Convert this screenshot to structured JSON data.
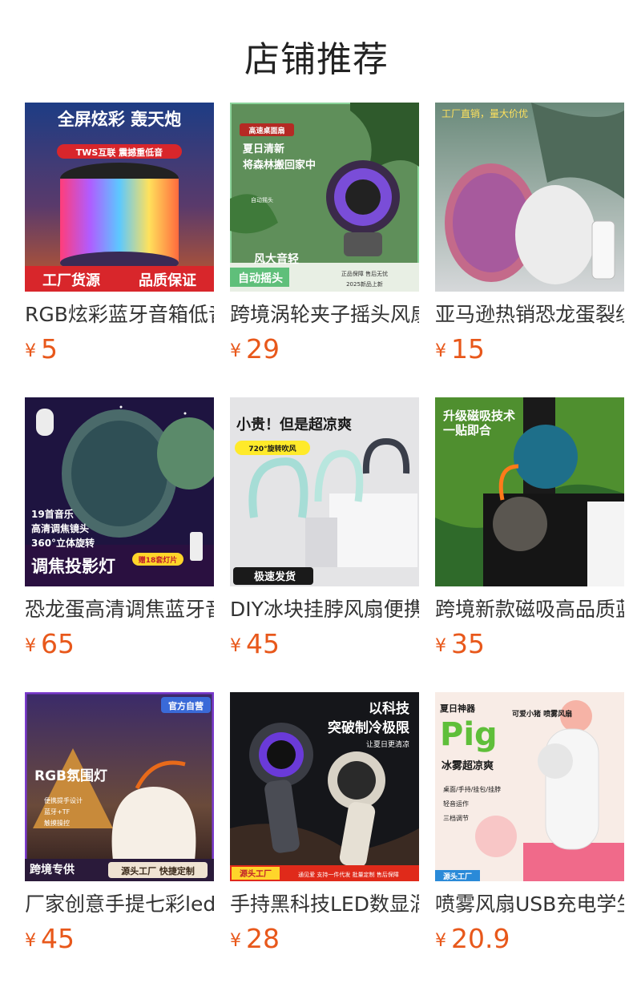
{
  "header": {
    "title": "店铺推荐"
  },
  "currency_symbol": "¥",
  "products": [
    {
      "name": "RGB炫彩蓝牙音箱低音炮",
      "price": "5",
      "image_texts": [
        "全屏炫彩 轰天炮",
        "TWS互联 震撼重低音",
        "工厂货源",
        "品质保证"
      ]
    },
    {
      "name": "跨境涡轮夹子摇头风扇",
      "price": "29",
      "image_texts": [
        "高速桌面扇",
        "夏日清新",
        "将森林搬回家中",
        "自动摇头",
        "风大音轻",
        "自动摇头",
        "正品保障 售后无忧",
        "2025新品上新"
      ]
    },
    {
      "name": "亚马逊热销恐龙蛋裂纹",
      "price": "15",
      "image_texts": [
        "工厂直销，量大价优"
      ]
    },
    {
      "name": "恐龙蛋高清调焦蓝牙音箱",
      "price": "65",
      "image_texts": [
        "19首音乐",
        "高清调焦镜头",
        "360°立体旋转",
        "调焦投影灯",
        "赠18套灯片"
      ]
    },
    {
      "name": "DIY冰块挂脖风扇便携",
      "price": "45",
      "image_texts": [
        "小贵！但是超凉爽",
        "720°旋转吹风",
        "极速发货"
      ]
    },
    {
      "name": "跨境新款磁吸高品质蓝牙",
      "price": "35",
      "image_texts": [
        "升级磁吸技术",
        "一贴即合"
      ]
    },
    {
      "name": "厂家创意手提七彩led",
      "price": "45",
      "image_texts": [
        "官方自营",
        "RGB氛围灯",
        "便携提手设计",
        "蓝牙+TF",
        "触摸操控",
        "跨境专供",
        "源头工厂 快捷定制"
      ]
    },
    {
      "name": "手持黑科技LED数显涡轮",
      "price": "28",
      "image_texts": [
        "以科技",
        "突破制冷极限",
        "让夏日更清凉",
        "源头工厂",
        "通见爱 支持一件代发 批量定制 售后保障"
      ]
    },
    {
      "name": "喷雾风扇USB充电学生",
      "price": "20.9",
      "image_texts": [
        "夏日神器",
        "Pig",
        "可爱小猪 喷雾风扇",
        "冰雾超凉爽",
        "桌面/手持/挂包/挂脖",
        "轻音运作",
        "三档调节",
        "源头工厂"
      ]
    }
  ],
  "colors": {
    "price": "#e8581b",
    "title": "#222222",
    "name": "#333333"
  }
}
